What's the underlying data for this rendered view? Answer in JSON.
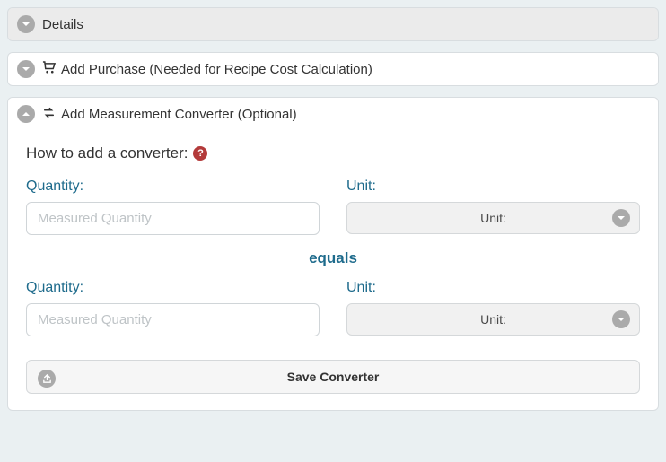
{
  "panels": {
    "details": {
      "title": "Details",
      "expanded": false
    },
    "purchase": {
      "title": "Add Purchase (Needed for Recipe Cost Calculation)",
      "expanded": false
    },
    "converter": {
      "title": "Add Measurement Converter (Optional)",
      "expanded": true
    }
  },
  "converter_form": {
    "instructions": "How to add a converter:",
    "help_glyph": "?",
    "from": {
      "quantity_label": "Quantity:",
      "quantity_placeholder": "Measured Quantity",
      "quantity_value": "",
      "unit_label": "Unit:",
      "unit_selected": "Unit:"
    },
    "equals_label": "equals",
    "to": {
      "quantity_label": "Quantity:",
      "quantity_placeholder": "Measured Quantity",
      "quantity_value": "",
      "unit_label": "Unit:",
      "unit_selected": "Unit:"
    },
    "save_label": "Save Converter"
  }
}
